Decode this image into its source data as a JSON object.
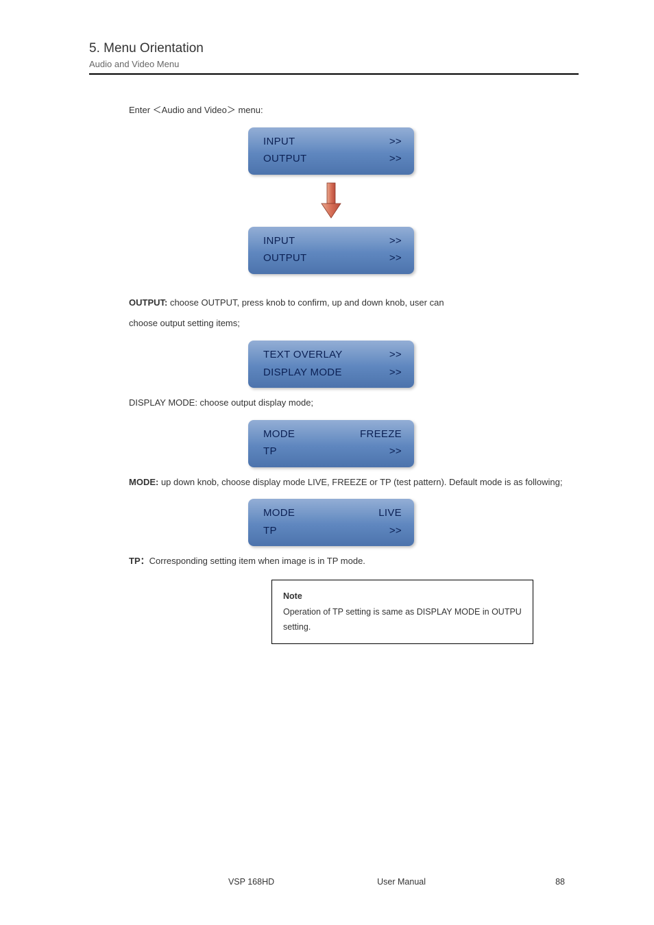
{
  "header": {
    "section_num": "5. Menu Orientation",
    "subtitle": "Audio and Video Menu"
  },
  "para1": "Enter ＜Audio and Video＞ menu:",
  "panel1": {
    "row1": {
      "label": "INPUT",
      "val": ">>"
    },
    "row2": {
      "label": "OUTPUT",
      "val": ">>"
    }
  },
  "panel2": {
    "row1": {
      "label": "INPUT",
      "val": ">>"
    },
    "row2": {
      "label": "OUTPUT",
      "val": ">>"
    }
  },
  "para2_prefix": "OUTPUT:",
  "para2_body": " choose OUTPUT, press knob to confirm, up and down knob, user can",
  "para2_line2": "choose output setting items;",
  "panel3": {
    "row1": {
      "label": "TEXT OVERLAY",
      "val": ">>"
    },
    "row2": {
      "label": "DISPLAY MODE",
      "val": ">>"
    }
  },
  "display_mode_line": "DISPLAY MODE: choose output display mode;",
  "panel4": {
    "row1": {
      "label": "MODE",
      "val": "FREEZE"
    },
    "row2": {
      "label": "TP",
      "val": ">>"
    }
  },
  "mode_lead": "MODE: ",
  "mode_body": "up down knob, choose display mode LIVE, FREEZE or TP (test pattern). Default mode is as following;",
  "panel5": {
    "row1": {
      "label": "MODE",
      "val": "LIVE"
    },
    "row2": {
      "label": "TP",
      "val": ">>"
    }
  },
  "tp_lead": "TP：",
  "tp_body": "Corresponding setting item when image is in TP mode.",
  "note_lead": "Note",
  "note_body": "Operation of TP setting is same as DISPLAY MODE in OUTPU setting.",
  "footer": {
    "model": "VSP 168HD",
    "center": "User Manual",
    "page": "88"
  }
}
